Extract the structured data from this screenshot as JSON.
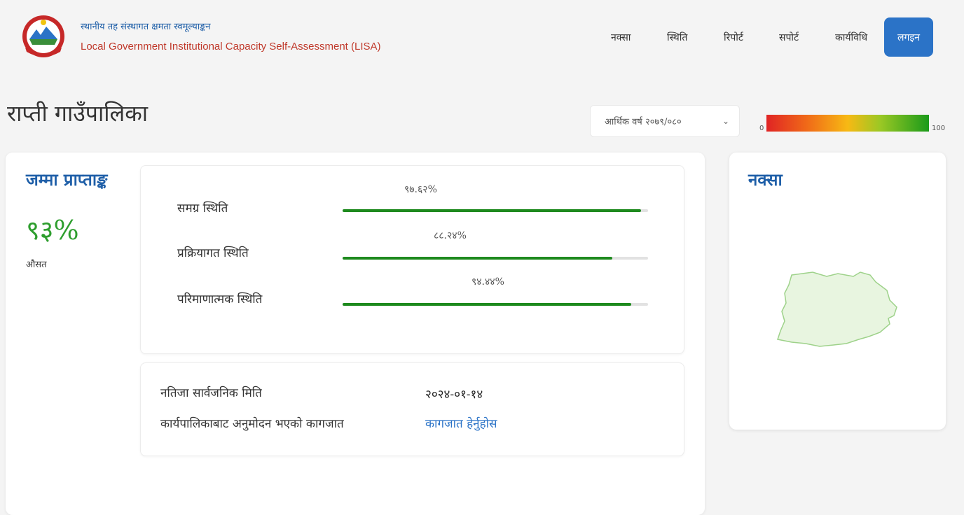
{
  "header": {
    "title_ne": "स्थानीय तह संस्थागत क्षमता स्वमूल्याङ्कन",
    "title_en": "Local Government Institutional Capacity Self-Assessment (LISA)",
    "logo_icon": "nepal-emblem-icon",
    "nav": [
      {
        "label": "नक्सा"
      },
      {
        "label": "स्थिति"
      },
      {
        "label": "रिपोर्ट"
      },
      {
        "label": "सपोर्ट"
      },
      {
        "label": "कार्यविधि"
      }
    ],
    "login_label": "लगइन"
  },
  "page": {
    "title": "राप्ती गाउँपालिका",
    "fiscal_year_select": "आर्थिक वर्ष २०७९/०८०",
    "scale_min": "0",
    "scale_max": "100"
  },
  "summary": {
    "heading": "जम्मा प्राप्ताङ्क",
    "value": "९३%",
    "label": "औसत"
  },
  "status": [
    {
      "label": "समग्र स्थिति",
      "pct_text": "९७.६२%",
      "fraction": 0.9762
    },
    {
      "label": "प्रक्रियागत स्थिति",
      "pct_text": "८८.२४%",
      "fraction": 0.8824
    },
    {
      "label": "परिमाणात्मक स्थिति",
      "pct_text": "९४.४४%",
      "fraction": 0.9444
    }
  ],
  "info": {
    "publish_date_label": "नतिजा सार्वजनिक मिति",
    "publish_date_value": "२०२४-०१-१४",
    "approval_doc_label": "कार्यपालिकाबाट अनुमोदन भएको कागजात",
    "approval_doc_link": "कागजात हेर्नुहोस"
  },
  "map": {
    "heading": "नक्सा",
    "fill_color": "#e8f5e0",
    "stroke_color": "#9ed28a"
  },
  "colors": {
    "accent": "#2b73c7",
    "heading": "#1f5fa8",
    "progress": "#1e8a1e",
    "score": "#2e9e2e"
  }
}
